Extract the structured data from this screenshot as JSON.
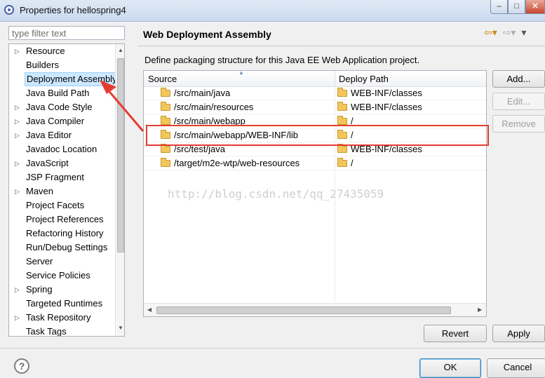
{
  "window": {
    "title": "Properties for hellospring4",
    "min": "–",
    "max": "□",
    "close": "✕"
  },
  "filter": {
    "placeholder": "type filter text"
  },
  "nav": {
    "items": [
      {
        "label": "Resource",
        "expandable": true
      },
      {
        "label": "Builders",
        "expandable": false
      },
      {
        "label": "Deployment Assembly",
        "expandable": false,
        "selected": true
      },
      {
        "label": "Java Build Path",
        "expandable": false
      },
      {
        "label": "Java Code Style",
        "expandable": true
      },
      {
        "label": "Java Compiler",
        "expandable": true
      },
      {
        "label": "Java Editor",
        "expandable": true
      },
      {
        "label": "Javadoc Location",
        "expandable": false
      },
      {
        "label": "JavaScript",
        "expandable": true
      },
      {
        "label": "JSP Fragment",
        "expandable": false
      },
      {
        "label": "Maven",
        "expandable": true
      },
      {
        "label": "Project Facets",
        "expandable": false
      },
      {
        "label": "Project References",
        "expandable": false
      },
      {
        "label": "Refactoring History",
        "expandable": false
      },
      {
        "label": "Run/Debug Settings",
        "expandable": false
      },
      {
        "label": "Server",
        "expandable": false
      },
      {
        "label": "Service Policies",
        "expandable": false
      },
      {
        "label": "Spring",
        "expandable": true
      },
      {
        "label": "Targeted Runtimes",
        "expandable": false
      },
      {
        "label": "Task Repository",
        "expandable": true
      },
      {
        "label": "Task Tags",
        "expandable": false
      }
    ]
  },
  "page": {
    "title": "Web Deployment Assembly",
    "description": "Define packaging structure for this Java EE Web Application project."
  },
  "table": {
    "columns": [
      "Source",
      "Deploy Path"
    ],
    "rows": [
      {
        "source": "/src/main/java",
        "deploy": "WEB-INF/classes"
      },
      {
        "source": "/src/main/resources",
        "deploy": "WEB-INF/classes"
      },
      {
        "source": "/src/main/webapp",
        "deploy": "/"
      },
      {
        "source": "/src/main/webapp/WEB-INF/lib",
        "deploy": "/"
      },
      {
        "source": "/src/test/java",
        "deploy": "WEB-INF/classes"
      },
      {
        "source": "/target/m2e-wtp/web-resources",
        "deploy": "/"
      }
    ],
    "highlighted_row": 3,
    "watermark": "http://blog.csdn.net/qq_27435059"
  },
  "buttons": {
    "add": "Add...",
    "edit": "Edit...",
    "remove": "Remove",
    "revert": "Revert",
    "apply": "Apply",
    "ok": "OK",
    "cancel": "Cancel",
    "help": "?"
  },
  "colors": {
    "annotation": "#e53c32",
    "selection": "#cde8ff",
    "folder": "#f2c65a"
  }
}
